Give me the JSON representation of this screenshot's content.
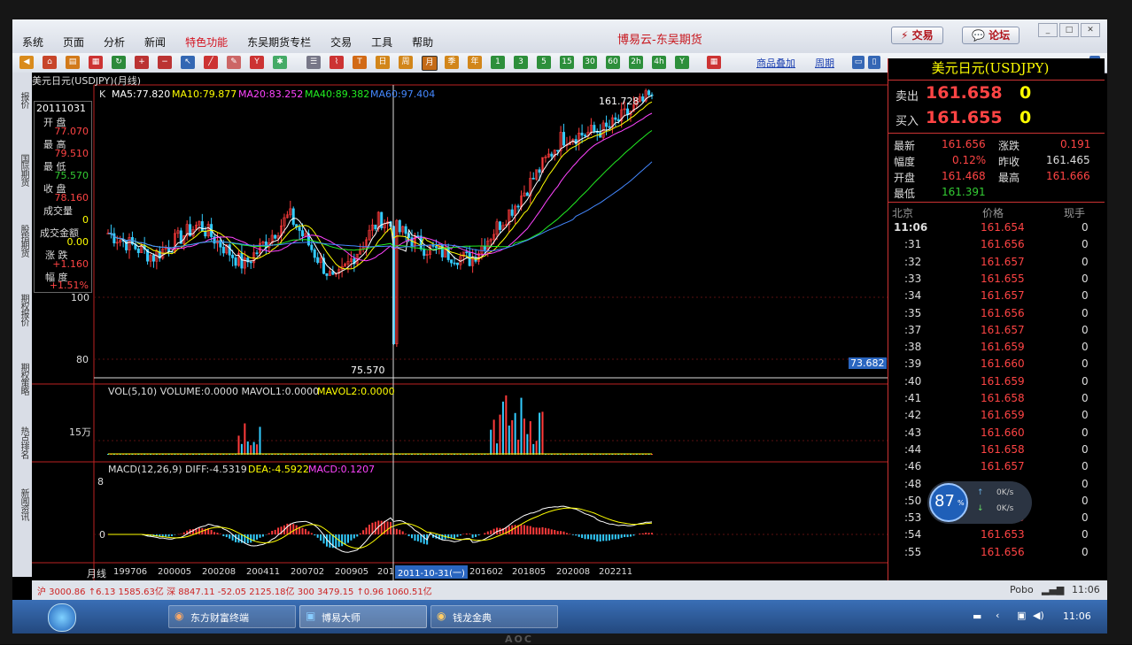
{
  "window": {
    "title": "博易云-东吴期货",
    "trade_btn": "⚡ 交易",
    "forum_btn": "💬 论坛"
  },
  "menu": [
    "系统",
    "页面",
    "分析",
    "新闻",
    "特色功能",
    "东吴期货专栏",
    "交易",
    "工具",
    "帮助"
  ],
  "menu_highlight_index": 4,
  "toolbar_links": {
    "overlay": "商品叠加",
    "period": "周期"
  },
  "side_tabs": [
    "报价",
    "国际期货",
    "股指期货",
    "期权报价",
    "期权策略",
    "热点排名",
    "新闻资讯"
  ],
  "chart": {
    "header": "美元日元(USDJPY)(月线)",
    "k_label": "K",
    "ma": {
      "ma5": "MA5:77.820",
      "ma10": "MA10:79.877",
      "ma20": "MA20:83.252",
      "ma40": "MA40:89.382",
      "ma60": "MA60:97.404"
    },
    "colors": {
      "ma5": "#ffffff",
      "ma10": "#ffff00",
      "ma20": "#ff44ff",
      "ma40": "#22ee22",
      "ma60": "#4488ff",
      "up": "#ff3b3b",
      "down": "#33ccff"
    },
    "info": {
      "date": "20111031",
      "open_label": "开 盘",
      "open": "77.070",
      "high_label": "最 高",
      "high": "79.510",
      "low_label": "最 低",
      "low": "75.570",
      "close_label": "收 盘",
      "close": "78.160",
      "vol_label": "成交量",
      "vol": "0",
      "amount_label": "成交金额",
      "amount": "0.00",
      "change_label": "涨 跌",
      "change": "+1.160",
      "pct_label": "幅 度",
      "pct": "+1.51%"
    },
    "y_ticks": [
      "100",
      "80"
    ],
    "price_max_label": "161.728",
    "price_min_label": "75.570",
    "cursor_price": "73.682",
    "vol": {
      "header": "VOL(5,10) VOLUME:0.0000 MAVOL1:0.0000",
      "mavol2": "MAVOL2:0.0000",
      "tick": "15万"
    },
    "macd": {
      "header": "MACD(12,26,9) DIFF:-4.5319",
      "dea": "DEA:-4.5922",
      "macd": "MACD:0.1207",
      "tick_top": "8",
      "tick_zero": "0"
    },
    "x_axis": {
      "period_label": "月线",
      "labels": [
        "199706",
        "200005",
        "200208",
        "200411",
        "200702",
        "200905",
        "201",
        "201602",
        "201805",
        "202008",
        "202211"
      ],
      "cursor_date": "2011-10-31(一)"
    }
  },
  "chart_data": {
    "type": "candlestick",
    "title": "美元日元(USDJPY)(月线)",
    "x_labels": [
      "199706",
      "200005",
      "200208",
      "200411",
      "200702",
      "200905",
      "201602",
      "201805",
      "202008",
      "202211"
    ],
    "close_approx": [
      115,
      107,
      118,
      104,
      121,
      98,
      120,
      110,
      106,
      125,
      147,
      150,
      161.658
    ],
    "price_extremes": {
      "high": 161.728,
      "low": 75.57
    },
    "selected_bar": {
      "date": "20111031",
      "open": 77.07,
      "high": 79.51,
      "low": 75.57,
      "close": 78.16,
      "change": 1.16,
      "pct": "+1.51%"
    }
  },
  "quote": {
    "name": "美元日元(USDJPY)",
    "sell_label": "卖出",
    "sell": "161.658",
    "sell_qty": "0",
    "buy_label": "买入",
    "buy": "161.655",
    "buy_qty": "0",
    "last_label": "最新",
    "last": "161.656",
    "chg_label": "涨跌",
    "chg": "0.191",
    "pct_label": "幅度",
    "pct": "0.12%",
    "prev_label": "昨收",
    "prev": "161.465",
    "open_label": "开盘",
    "open": "161.468",
    "high_label": "最高",
    "high": "161.666",
    "low_label": "最低",
    "low": "161.391"
  },
  "ticks_header": {
    "time": "北京",
    "price": "价格",
    "qty": "现手"
  },
  "ticks": [
    {
      "t": "11:06",
      "p": "161.654",
      "q": "0"
    },
    {
      "t": ":31",
      "p": "161.656",
      "q": "0"
    },
    {
      "t": ":32",
      "p": "161.657",
      "q": "0"
    },
    {
      "t": ":33",
      "p": "161.655",
      "q": "0"
    },
    {
      "t": ":34",
      "p": "161.657",
      "q": "0"
    },
    {
      "t": ":35",
      "p": "161.656",
      "q": "0"
    },
    {
      "t": ":37",
      "p": "161.657",
      "q": "0"
    },
    {
      "t": ":38",
      "p": "161.659",
      "q": "0"
    },
    {
      "t": ":39",
      "p": "161.660",
      "q": "0"
    },
    {
      "t": ":40",
      "p": "161.659",
      "q": "0"
    },
    {
      "t": ":41",
      "p": "161.658",
      "q": "0"
    },
    {
      "t": ":42",
      "p": "161.659",
      "q": "0"
    },
    {
      "t": ":43",
      "p": "161.660",
      "q": "0"
    },
    {
      "t": ":44",
      "p": "161.658",
      "q": "0"
    },
    {
      "t": ":46",
      "p": "161.657",
      "q": "0"
    },
    {
      "t": ":48",
      "p": "",
      "q": "0"
    },
    {
      "t": ":50",
      "p": "",
      "q": "0"
    },
    {
      "t": ":53",
      "p": "161.655",
      "q": "0"
    },
    {
      "t": ":54",
      "p": "161.653",
      "q": "0"
    },
    {
      "t": ":55",
      "p": "161.656",
      "q": "0"
    }
  ],
  "net_widget": {
    "pct": "87",
    "pct_unit": "%",
    "up": "0K/s",
    "down": "0K/s"
  },
  "status": {
    "left": "沪  3000.86   ↑6.13  1585.63亿   深   8847.11   -52.05  2125.18亿   300  3479.15   ↑0.96  1060.51亿",
    "brand": "Pobo",
    "time": "11:06"
  },
  "taskbar": {
    "items": [
      "东方财富终端",
      "博易大师",
      "钱龙金典"
    ],
    "clock": "11:06"
  },
  "monitor_brand": "AOC"
}
